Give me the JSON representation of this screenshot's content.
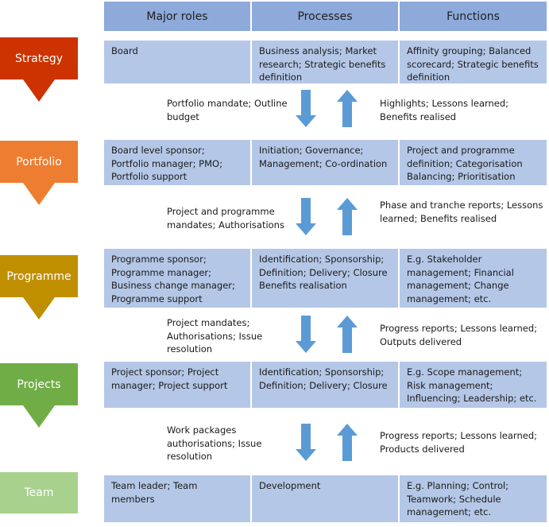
{
  "header": {
    "columns": [
      "Major roles",
      "Processes",
      "Functions"
    ]
  },
  "levels": [
    {
      "name": "Strategy",
      "color": "#cc3300",
      "roles": "Board",
      "processes": "Business analysis; Market research; Strategic benefits definition",
      "functions": "Affinity grouping; Balanced scorecard; Strategic benefits definition"
    },
    {
      "name": "Portfolio",
      "color": "#ed7d31",
      "roles": "Board level sponsor; Portfolio manager; PMO; Portfolio support",
      "processes": "Initiation; Governance; Management; Co-ordination",
      "functions": "Project and programme definition; Categorisation Balancing; Prioritisation"
    },
    {
      "name": "Programme",
      "color": "#bf8f00",
      "roles": "Programme sponsor; Programme manager; Business change manager; Programme support",
      "processes": "Identification; Sponsorship; Definition; Delivery; Closure Benefits realisation",
      "functions": "E.g. Stakeholder management; Financial management; Change management; etc."
    },
    {
      "name": "Projects",
      "color": "#70ad47",
      "roles": "Project sponsor; Project manager; Project support",
      "processes": "Identification; Sponsorship; Definition; Delivery; Closure",
      "functions": "E.g. Scope management; Risk management; Influencing; Leadership; etc."
    },
    {
      "name": "Team",
      "color": "#a9d18e",
      "roles": "Team leader; Team members",
      "processes": "Development",
      "functions": "E.g. Planning; Control; Teamwork; Schedule management; etc."
    }
  ],
  "flows": [
    {
      "down": "Portfolio mandate; Outline budget",
      "up": "Highlights; Lessons learned; Benefits realised"
    },
    {
      "down": "Project and programme mandates; Authorisations",
      "up": "Phase and tranche reports; Lessons learned; Benefits realised"
    },
    {
      "down": "Project mandates; Authorisations; Issue resolution",
      "up": "Progress reports; Lessons learned; Outputs delivered"
    },
    {
      "down": "Work packages authorisations; Issue resolution",
      "up": "Progress reports; Lessons learned; Products delivered"
    }
  ],
  "colors": {
    "header_fill": "#8eaadb",
    "cell_fill": "#b4c7e7",
    "flow_arrow": "#5b9bd5"
  }
}
